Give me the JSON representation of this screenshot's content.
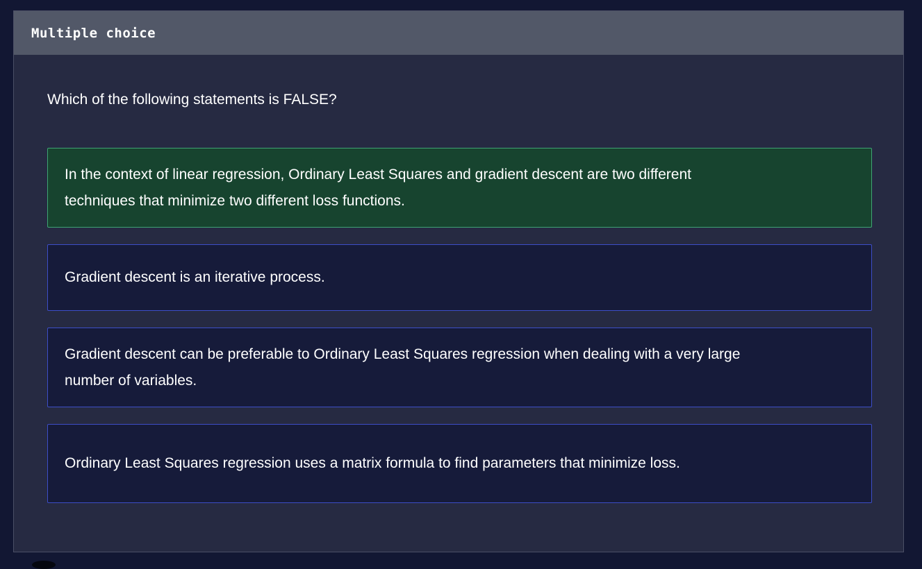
{
  "header": {
    "title": "Multiple choice"
  },
  "question": {
    "text": "Which of the following statements is FALSE?"
  },
  "options": [
    {
      "text": "In the context of linear regression, Ordinary Least Squares and gradient descent are two different techniques that minimize two different loss functions.",
      "selected": true
    },
    {
      "text": "Gradient descent is an iterative process.",
      "selected": false
    },
    {
      "text": "Gradient descent can be preferable to Ordinary Least Squares regression when dealing with a very large number of variables.",
      "selected": false
    },
    {
      "text": "Ordinary Least Squares regression uses a matrix formula to find parameters that minimize loss.",
      "selected": false
    }
  ],
  "colors": {
    "page_background": "#121733",
    "panel_background": "#262a42",
    "header_background": "#525868",
    "option_background": "#161b3a",
    "option_border": "#3d4ec8",
    "selected_background": "#17442f",
    "selected_border": "#3fa474"
  }
}
